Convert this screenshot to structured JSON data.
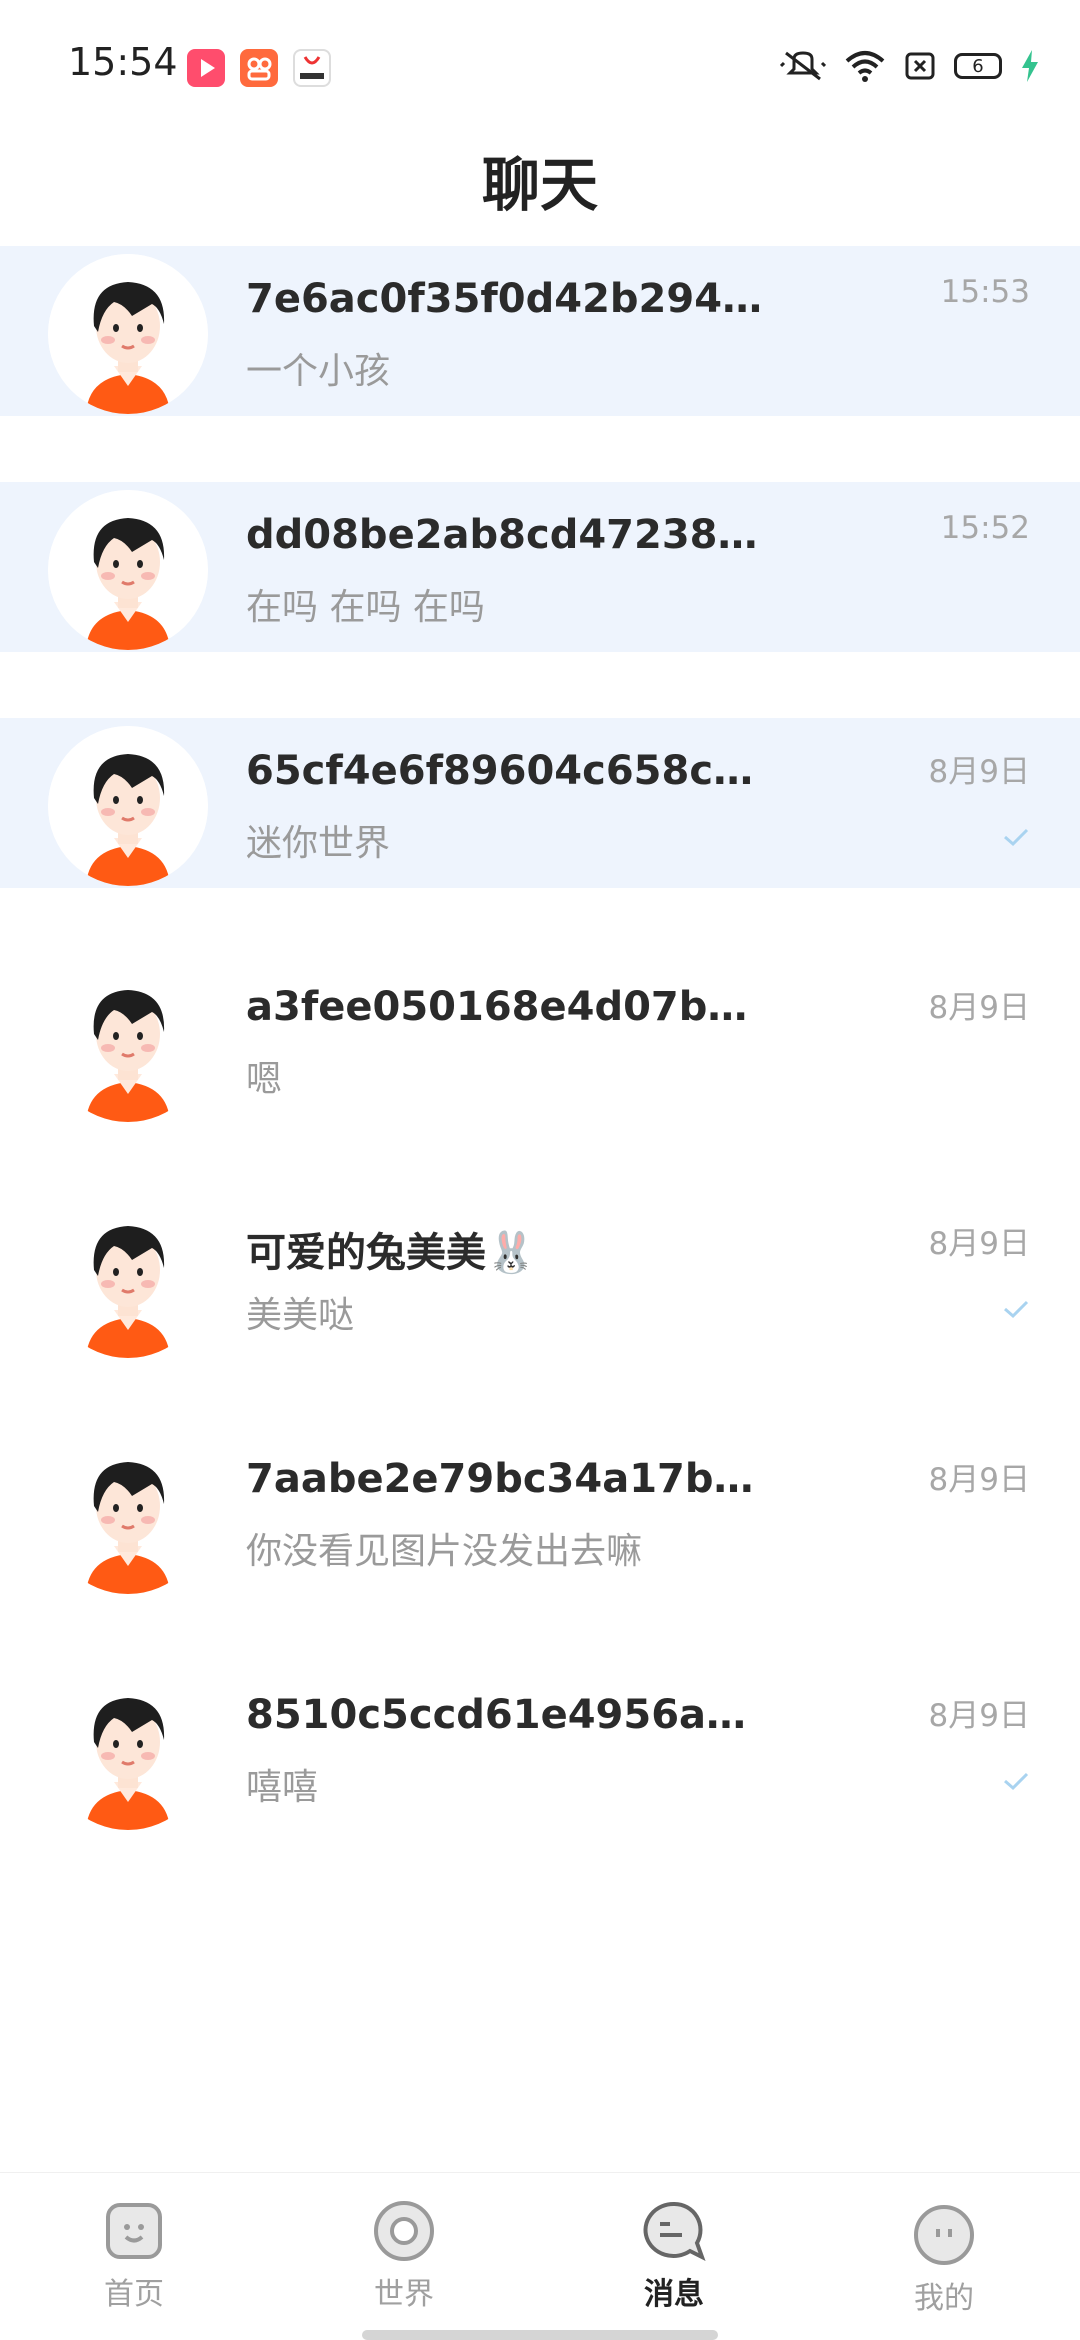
{
  "status_bar": {
    "time": "15:54",
    "battery": "6",
    "app_icons": [
      "video-app-icon",
      "group-app-icon",
      "store-app-icon"
    ],
    "system_icons": [
      "mute-icon",
      "wifi-icon",
      "sim-icon",
      "battery-icon",
      "charging-icon"
    ]
  },
  "header": {
    "title": "聊天"
  },
  "chats": [
    {
      "name": "7e6ac0f35f0d42b294ce8...",
      "message": "一个小孩",
      "time": "15:53",
      "pinned": true,
      "read_check": false
    },
    {
      "name": "dd08be2ab8cd47238eecc...",
      "message": "在吗 在吗 在吗",
      "time": "15:52",
      "pinned": true,
      "read_check": false
    },
    {
      "name": "65cf4e6f89604c658c9fb...",
      "message": "迷你世界",
      "time": "8月9日",
      "pinned": true,
      "read_check": true
    },
    {
      "name": "a3fee050168e4d07bd32...",
      "message": "嗯",
      "time": "8月9日",
      "pinned": false,
      "read_check": false
    },
    {
      "name": "可爱的兔美美🐰",
      "message": "  美美哒",
      "time": "8月9日",
      "pinned": false,
      "read_check": true
    },
    {
      "name": "7aabe2e79bc34a17b9bb...",
      "message": "你没看见图片没发出去嘛",
      "time": "8月9日",
      "pinned": false,
      "read_check": false
    },
    {
      "name": "8510c5ccd61e4956aa64...",
      "message": "嘻嘻",
      "time": "8月9日",
      "pinned": false,
      "read_check": true
    }
  ],
  "bottom_nav": {
    "items": [
      {
        "label": "首页",
        "icon": "home-face-icon",
        "active": false
      },
      {
        "label": "世界",
        "icon": "world-ring-icon",
        "active": false
      },
      {
        "label": "消息",
        "icon": "message-bubble-icon",
        "active": true
      },
      {
        "label": "我的",
        "icon": "profile-face-icon",
        "active": false
      }
    ]
  },
  "colors": {
    "pinned_bg": "#eef4fd",
    "check": "#a9d3f0",
    "avatar_shirt": "#ff5a14",
    "avatar_hair": "#1e1e1e"
  }
}
